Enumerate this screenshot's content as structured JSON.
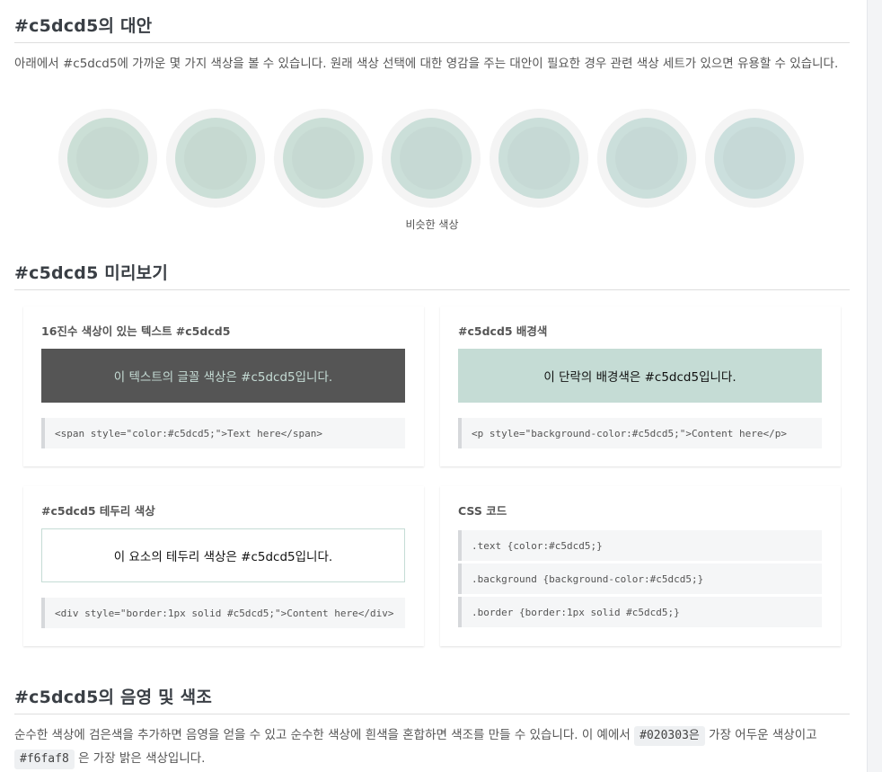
{
  "colors": {
    "base": "#c5dcd5",
    "dark_box_bg": "#555555",
    "similar": [
      "#c5dcd1",
      "#c5dcd2",
      "#c5dcd3",
      "#c5dcd5",
      "#c5dcd6",
      "#c5dcd7",
      "#c5dcd9"
    ]
  },
  "alternatives": {
    "title": "#c5dcd5의 대안",
    "description": "아래에서 #c5dcd5에 가까운 몇 가지 색상을 볼 수 있습니다. 원래 색상 선택에 대한 영감을 주는 대안이 필요한 경우 관련 색상 세트가 있으면 유용할 수 있습니다.",
    "similar_label": "비슷한 색상"
  },
  "preview": {
    "title": "#c5dcd5 미리보기",
    "text_card": {
      "title": "16진수 색상이 있는 텍스트 #c5dcd5",
      "demo": "이 텍스트의 글꼴 색상은 #c5dcd5입니다.",
      "code": "<span style=\"color:#c5dcd5;\">Text here</span>"
    },
    "bg_card": {
      "title": "#c5dcd5 배경색",
      "demo": "이 단락의 배경색은 #c5dcd5입니다.",
      "code": "<p style=\"background-color:#c5dcd5;\">Content here</p>"
    },
    "border_card": {
      "title": "#c5dcd5 테두리 색상",
      "demo": "이 요소의 테두리 색상은 #c5dcd5입니다.",
      "code": "<div style=\"border:1px solid #c5dcd5;\">Content here</div>"
    },
    "css_card": {
      "title": "CSS 코드",
      "lines": [
        ".text {color:#c5dcd5;}",
        ".background {background-color:#c5dcd5;}",
        ".border {border:1px solid #c5dcd5;}"
      ]
    }
  },
  "shades": {
    "title": "#c5dcd5의 음영 및 색조",
    "text_before": "순수한 색상에 검은색을 추가하면 음영을 얻을 수 있고 순수한 색상에 흰색을 혼합하면 색조를 만들 수 있습니다. 이 예에서",
    "darkest": "#020303은",
    "text_mid": "가장 어두운 색상이고",
    "lightest": "#f6faf8",
    "text_after": "은 가장 밝은 색상입니다."
  }
}
